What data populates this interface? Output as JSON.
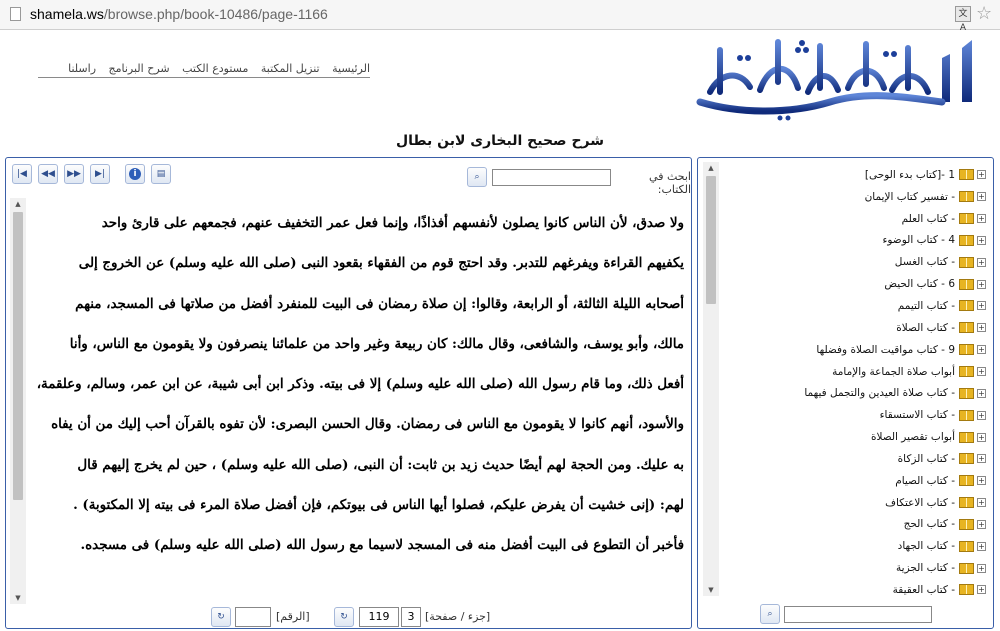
{
  "browser": {
    "url_host": "shamela.ws",
    "url_path": "/browse.php/book-10486/page-1166",
    "translate_icon": "translate-icon",
    "bookmark_icon": "star-icon"
  },
  "nav": [
    "الرئيسية",
    "تنزيل المكتبة",
    "مستودع الكتب",
    "شرح البرنامج",
    "راسلنا"
  ],
  "logo_text": "المكتبة الشاملة",
  "book_title": "شرح صحيح البخارى لابن بطال",
  "toolbar": {
    "search_label": "ابحث في الكتاب:",
    "search_value": ""
  },
  "content_lines": [
    "ولا صدق، لأن الناس كانوا يصلون لأنفسهم أفذاذًا، وإنما فعل عمر التخفيف عنهم، فجمعهم على قارئ واحد",
    "يكفيهم القراءة ويفرغهم للتدبر. وقد احتج قوم من الفقهاء بقعود النبى (صلى الله عليه وسلم) عن الخروج إلى",
    "أصحابه الليلة الثالثة، أو الرابعة، وقالوا: إن صلاة رمضان فى البيت للمنفرد أفضل من صلاتها فى المسجد، منهم",
    "مالك، وأبو يوسف، والشافعى، وقال مالك: كان ربيعة وغير واحد من علمائنا ينصرفون ولا يقومون مع الناس، وأنا",
    "أفعل ذلك، وما قام رسول الله (صلى الله عليه وسلم) إلا فى بيته. وذكر ابن أبى شيبة، عن ابن عمر، وسالم، وعلقمة،",
    "والأسود، أنهم كانوا لا يقومون مع الناس فى رمضان. وقال الحسن البصرى: لأن تفوه بالقرآن أحب إليك من أن يفاه",
    "به عليك. ومن الحجة لهم أيضًا حديث زيد بن ثابت: أن النبى، (صلى الله عليه وسلم) ، حين لم يخرج إليهم قال",
    "لهم: (إنى خشيت أن يفرض عليكم، فصلوا أيها الناس فى بيوتكم، فإن أفضل صلاة المرء فى بيته إلا المكتوبة) .",
    "فأخبر أن التطوع فى البيت أفضل منه فى المسجد لاسيما مع رسول الله (صلى الله عليه وسلم) فى مسجده."
  ],
  "pager": {
    "part_page_label": "[جزء / صفحة]",
    "part": "3",
    "page": "119",
    "number_label": "[الرقم]",
    "number_value": ""
  },
  "tree": [
    "1 -[كتاب بدء الوحى]",
    "- تفسير كتاب الإيمان",
    "- كتاب العلم",
    "4 - كتاب الوضوء",
    "- كتاب الغسل",
    "6 - كتاب الحيض",
    "- كتاب التيمم",
    "- كتاب الصلاة",
    "9 - كتاب مواقيت الصلاة وفضلها",
    "أبواب صلاة الجماعة والإمامة",
    "- كتاب صلاة العيدين والتجمل فيهما",
    "- كتاب الاستسقاء",
    "أبواب تقصير الصلاة",
    "- كتاب الزكاة",
    "- كتاب الصيام",
    "- كتاب الاعتكاف",
    "- كتاب الحج",
    "- كتاب الجهاد",
    "- كتاب الجزية",
    "- كتاب العقيقة"
  ],
  "side_search_value": "",
  "colors": {
    "panel_border": "#3a5fa8",
    "logo_blue": "#1d3f9a"
  }
}
